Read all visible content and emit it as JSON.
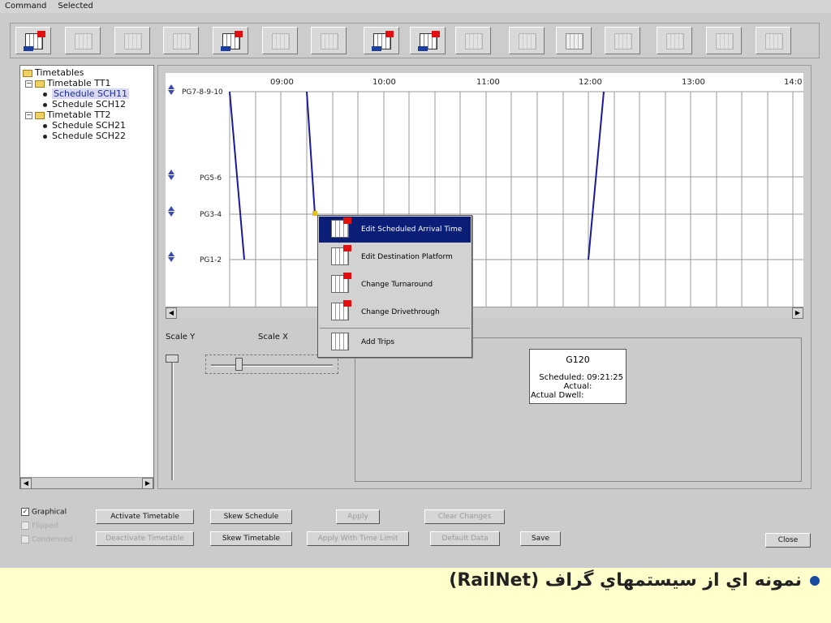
{
  "menu": [
    "Command",
    "Selected"
  ],
  "toolbar": {
    "buttons": [
      {
        "name": "edit-arrival-time-tool",
        "state": "enabled"
      },
      {
        "name": "grid-tool",
        "state": "disabled"
      },
      {
        "name": "clock-tool",
        "state": "disabled"
      },
      {
        "name": "clock-grid-tool",
        "state": "disabled"
      },
      {
        "name": "edit-destination-tool",
        "state": "enabled"
      },
      {
        "name": "turnaround-tool",
        "state": "disabled"
      },
      {
        "name": "platform-tool",
        "state": "disabled"
      },
      {
        "name": "change-turnaround-tool",
        "state": "enabled"
      },
      {
        "name": "change-drivethrough-tool",
        "state": "enabled"
      },
      {
        "name": "grid-small-tool",
        "state": "disabled"
      },
      {
        "name": "table-tool",
        "state": "disabled"
      },
      {
        "name": "add-trips-tool",
        "state": "enabled"
      },
      {
        "name": "remove-trips-tool",
        "state": "disabled"
      },
      {
        "name": "pin-tool",
        "state": "disabled"
      },
      {
        "name": "clock-pin-tool",
        "state": "disabled"
      },
      {
        "name": "settings-tool",
        "state": "disabled"
      }
    ]
  },
  "tree": {
    "root": "Timetables",
    "items": [
      {
        "label": "Timetable TT1",
        "type": "timetable"
      },
      {
        "label": "Schedule SCH11",
        "type": "schedule",
        "selected": true
      },
      {
        "label": "Schedule SCH12",
        "type": "schedule"
      },
      {
        "label": "Timetable TT2",
        "type": "timetable"
      },
      {
        "label": "Schedule SCH21",
        "type": "schedule"
      },
      {
        "label": "Schedule SCH22",
        "type": "schedule"
      }
    ]
  },
  "graph": {
    "times": [
      "09:00",
      "10:00",
      "11:00",
      "12:00",
      "13:00",
      "14:0"
    ],
    "stations": [
      "PG7-8-9-10",
      "PG5-6",
      "PG3-4",
      "PG1-2"
    ],
    "line_color": "#1a1a9a"
  },
  "sliders": {
    "scale_y": "Scale Y",
    "scale_x": "Scale X"
  },
  "context_menu": {
    "items": [
      {
        "label": "Edit Scheduled Arrival Time",
        "active": true
      },
      {
        "label": "Edit Destination Platform",
        "active": false
      },
      {
        "label": "Change Turnaround",
        "active": false
      },
      {
        "label": "Change Drivethrough",
        "active": false
      },
      {
        "label": "Add Trips",
        "active": false
      }
    ]
  },
  "train_info": {
    "id": "G120",
    "scheduled": "Scheduled: 09:21:25",
    "actual": "Actual:",
    "actual_dwell": "Actual Dwell:"
  },
  "options": {
    "graphical": "Graphical",
    "flipped": "Flipped",
    "condensed": "Condensed"
  },
  "buttons": {
    "activate_timetable": "Activate Timetable",
    "deactivate_timetable": "Deactivate Timetable",
    "skew_schedule": "Skew Schedule",
    "skew_timetable": "Skew Timetable",
    "apply": "Apply",
    "apply_with_time_limit": "Apply With Time Limit",
    "clear_changes": "Clear Changes",
    "default_data": "Default Data",
    "save": "Save",
    "close": "Close"
  },
  "caption": "نمونه اي از سيستمهاي گراف (RailNet)",
  "colors": {
    "accent": "#0a1e78",
    "slide_bg": "#ffffcc"
  }
}
